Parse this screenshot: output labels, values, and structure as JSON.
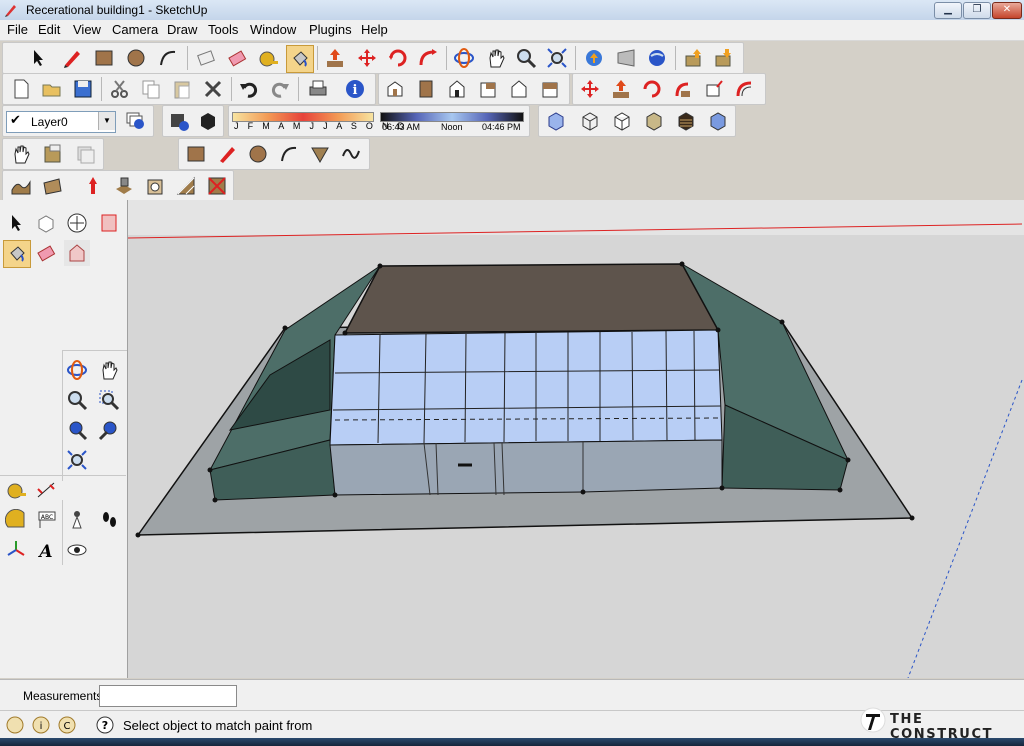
{
  "window": {
    "title": "Recerational building1 - SketchUp"
  },
  "window_controls": {
    "minimize": "▁",
    "maximize": "❐",
    "close": "✕"
  },
  "menu": [
    "File",
    "Edit",
    "View",
    "Camera",
    "Draw",
    "Tools",
    "Window",
    "Plugins",
    "Help"
  ],
  "layers": {
    "current": "Layer0",
    "check": "✔",
    "dropdown": "▼"
  },
  "shadows": {
    "months": "J F M A M J J A S O N D",
    "time_start": "06:43 AM",
    "time_mid": "Noon",
    "time_end": "04:46 PM"
  },
  "measurements": {
    "label": "Measurements",
    "value": ""
  },
  "status": {
    "text": "Select object to match paint from"
  },
  "branding": {
    "logo_text": "THE CONSTRUCT"
  },
  "icons": {
    "toolbar_row1": [
      "select-icon",
      "pencil-icon",
      "rectangle-icon",
      "circle-icon",
      "arc-icon",
      "erase-icon",
      "eraser-icon",
      "tape-measure-icon",
      "paint-bucket-icon",
      "push-pull-icon",
      "move-icon",
      "rotate-icon",
      "follow-me-icon",
      "orbit-icon",
      "pan-icon",
      "zoom-icon",
      "zoom-extents-icon",
      "get-models-icon",
      "share-model-icon",
      "google-earth-icon",
      "get-component-icon",
      "share-component-icon"
    ],
    "toolbar_row2": [
      "new-file-icon",
      "open-icon",
      "save-icon",
      "cut-icon",
      "copy-icon",
      "paste-icon",
      "delete-icon",
      "undo-icon",
      "redo-icon",
      "print-icon",
      "model-info-icon",
      "iso-view-icon",
      "top-view-icon",
      "front-view-icon",
      "right-view-icon",
      "back-view-icon",
      "left-view-icon",
      "move-sandbox-icon",
      "push-sandbox-icon",
      "rotate-sandbox-icon",
      "scale-icon",
      "offset-icon",
      "follow-me-2-icon"
    ]
  },
  "colors": {
    "viewport": "#d6d6d6",
    "glass": "#b8cef5",
    "roof": "#5e544c",
    "walls": "#3f5e58",
    "base": "#9ea3a6"
  }
}
